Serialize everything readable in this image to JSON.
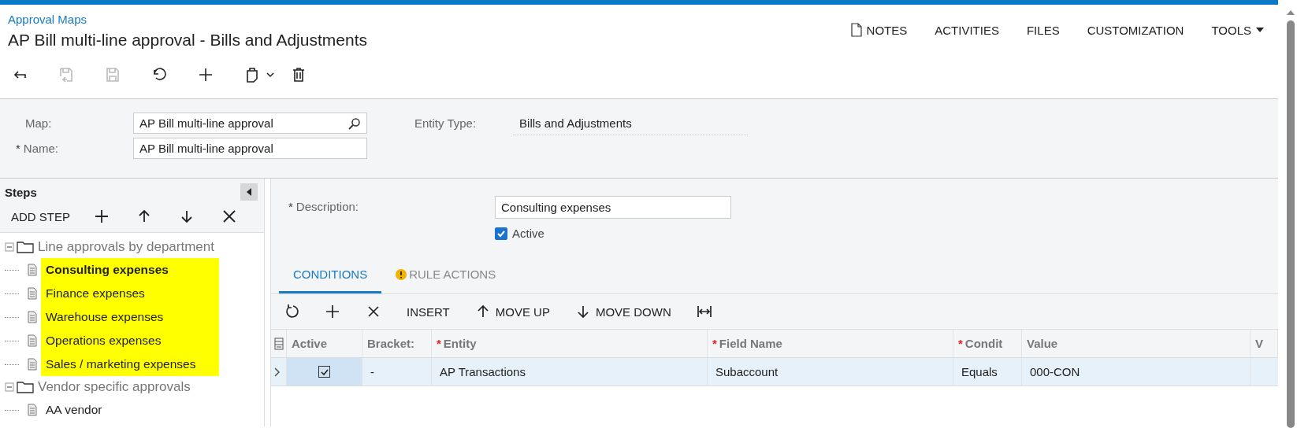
{
  "breadcrumb": "Approval Maps",
  "title": "AP Bill multi-line approval - Bills and Adjustments",
  "top_actions": [
    {
      "label": "NOTES",
      "kind": "notes"
    },
    {
      "label": "ACTIVITIES",
      "kind": "plain"
    },
    {
      "label": "FILES",
      "kind": "plain"
    },
    {
      "label": "CUSTOMIZATION",
      "kind": "plain"
    },
    {
      "label": "TOOLS",
      "kind": "menu"
    }
  ],
  "toolbar": [
    {
      "kind": "back",
      "disabled": false
    },
    {
      "kind": "save-close",
      "disabled": true
    },
    {
      "kind": "save",
      "disabled": true
    },
    {
      "kind": "undo",
      "disabled": false
    },
    {
      "kind": "add",
      "disabled": false
    },
    {
      "kind": "copy",
      "disabled": false
    },
    {
      "kind": "delete",
      "disabled": false
    }
  ],
  "form": {
    "map_label": "Map:",
    "map_value": "AP Bill multi-line approval",
    "name_label": "Name:",
    "name_mark": "*",
    "name_value": "AP Bill multi-line approval",
    "entity_type_label": "Entity Type:",
    "entity_type_value": "Bills and Adjustments"
  },
  "steps": {
    "title": "Steps",
    "add_step": "ADD STEP",
    "tree": [
      {
        "label": "Line approvals by department",
        "expanded": true,
        "children": [
          {
            "label": "Consulting expenses",
            "selected": true,
            "highlighted": true
          },
          {
            "label": "Finance expenses",
            "selected": false,
            "highlighted": true
          },
          {
            "label": "Warehouse expenses",
            "selected": false,
            "highlighted": true
          },
          {
            "label": "Operations expenses",
            "selected": false,
            "highlighted": true
          },
          {
            "label": "Sales / marketing expenses",
            "selected": false,
            "highlighted": true
          }
        ]
      },
      {
        "label": "Vendor specific approvals",
        "expanded": true,
        "children": [
          {
            "label": "AA vendor",
            "selected": false,
            "highlighted": false
          }
        ]
      }
    ]
  },
  "detail": {
    "description_mark": "*",
    "description_label": "Description:",
    "description_value": "Consulting expenses",
    "active_label": "Active",
    "active_checked": true
  },
  "tabs": [
    {
      "label": "CONDITIONS",
      "selected": true,
      "warning": false
    },
    {
      "label": "RULE ACTIONS",
      "selected": false,
      "warning": true
    }
  ],
  "grid_toolbar": [
    {
      "kind": "refresh"
    },
    {
      "kind": "add"
    },
    {
      "kind": "delete"
    },
    {
      "kind": "text",
      "label": "INSERT"
    },
    {
      "kind": "up",
      "label": "MOVE UP"
    },
    {
      "kind": "down",
      "label": "MOVE DOWN"
    },
    {
      "kind": "fit"
    }
  ],
  "table": {
    "columns": [
      {
        "label": "Active"
      },
      {
        "label": "Bracket:"
      },
      {
        "mark": "*",
        "label": "Entity"
      },
      {
        "mark": "*",
        "label": "Field Name"
      },
      {
        "mark": "*",
        "label": "Condit"
      },
      {
        "label": "Value"
      },
      {
        "label": "V"
      }
    ],
    "rows": [
      {
        "active": true,
        "selected": true,
        "cells": [
          "",
          "-",
          "AP Transactions",
          "Subaccount",
          "Equals",
          "000-CON"
        ]
      }
    ]
  }
}
